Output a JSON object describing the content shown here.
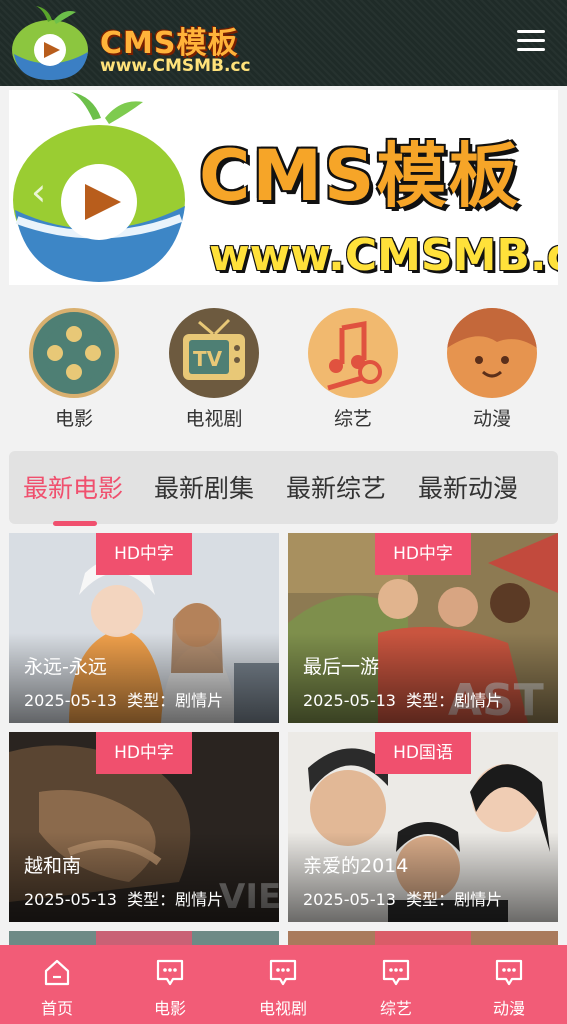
{
  "header": {
    "logo_title": "CMS模板",
    "logo_url": "www.CMSMB.cc",
    "menu_icon": "hamburger-menu-icon"
  },
  "banner": {
    "title": "CMS模板",
    "url": "www.CMSMB.cc",
    "prev_icon": "chevron-left-icon",
    "next_icon": "chevron-right-icon"
  },
  "categories": [
    {
      "label": "电影",
      "icon": "film-reel-icon"
    },
    {
      "label": "电视剧",
      "icon": "tv-icon"
    },
    {
      "label": "综艺",
      "icon": "music-note-icon"
    },
    {
      "label": "动漫",
      "icon": "cartoon-face-icon"
    }
  ],
  "tabs": [
    {
      "label": "最新电影",
      "active": true
    },
    {
      "label": "最新剧集",
      "active": false
    },
    {
      "label": "最新综艺",
      "active": false
    },
    {
      "label": "最新动漫",
      "active": false
    }
  ],
  "movies": [
    {
      "tag": "HD中字",
      "title": "永远-永远",
      "date": "2025-05-13",
      "type": "类型：剧情片"
    },
    {
      "tag": "HD中字",
      "title": "最后一游",
      "date": "2025-05-13",
      "type": "类型：剧情片"
    },
    {
      "tag": "HD中字",
      "title": "越和南",
      "date": "2025-05-13",
      "type": "类型：剧情片"
    },
    {
      "tag": "HD国语",
      "title": "亲爱的2014",
      "date": "2025-05-13",
      "type": "类型：剧情片"
    }
  ],
  "bottom_nav": [
    {
      "label": "首页",
      "icon": "home-icon"
    },
    {
      "label": "电影",
      "icon": "chat-bubble-icon"
    },
    {
      "label": "电视剧",
      "icon": "chat-bubble-icon"
    },
    {
      "label": "综艺",
      "icon": "chat-bubble-icon"
    },
    {
      "label": "动漫",
      "icon": "chat-bubble-icon"
    }
  ],
  "colors": {
    "accent": "#f0506e",
    "header_bg": "#1f2b28",
    "nav_bg": "#f25c77"
  }
}
